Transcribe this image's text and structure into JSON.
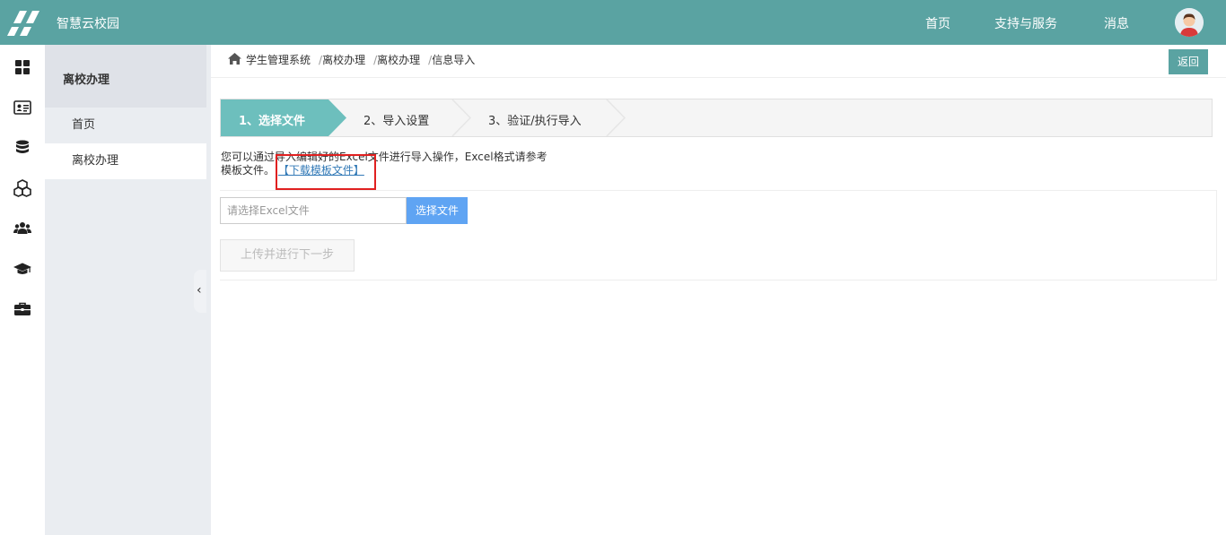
{
  "header": {
    "app_title": "智慧云校园",
    "nav": [
      {
        "label": "首页"
      },
      {
        "label": "支持与服务"
      },
      {
        "label": "消息"
      }
    ],
    "accent_color": "#5aa3a2"
  },
  "rail": {
    "icons": [
      "dashboard-icon",
      "id-card-icon",
      "database-icon",
      "cubes-icon",
      "users-icon",
      "graduation-cap-icon",
      "briefcase-icon"
    ]
  },
  "sidebar": {
    "title": "离校办理",
    "items": [
      {
        "label": "首页",
        "active": false
      },
      {
        "label": "离校办理",
        "active": true
      }
    ]
  },
  "breadcrumb": {
    "items": [
      "学生管理系统",
      "离校办理",
      "离校办理",
      "信息导入"
    ],
    "separator": "/"
  },
  "back_button": "返回",
  "steps": [
    {
      "label": "1、选择文件",
      "active": true
    },
    {
      "label": "2、导入设置",
      "active": false
    },
    {
      "label": "3、验证/执行导入",
      "active": false
    }
  ],
  "hint": {
    "line1": "您可以通过导入编辑好的Excel文件进行导入操作，Excel格式请参考",
    "line2": "模板文件。",
    "download_link": "【下载模板文件】"
  },
  "file_input": {
    "placeholder": "请选择Excel文件",
    "value": ""
  },
  "choose_button": "选择文件",
  "upload_button": "上传并进行下一步"
}
